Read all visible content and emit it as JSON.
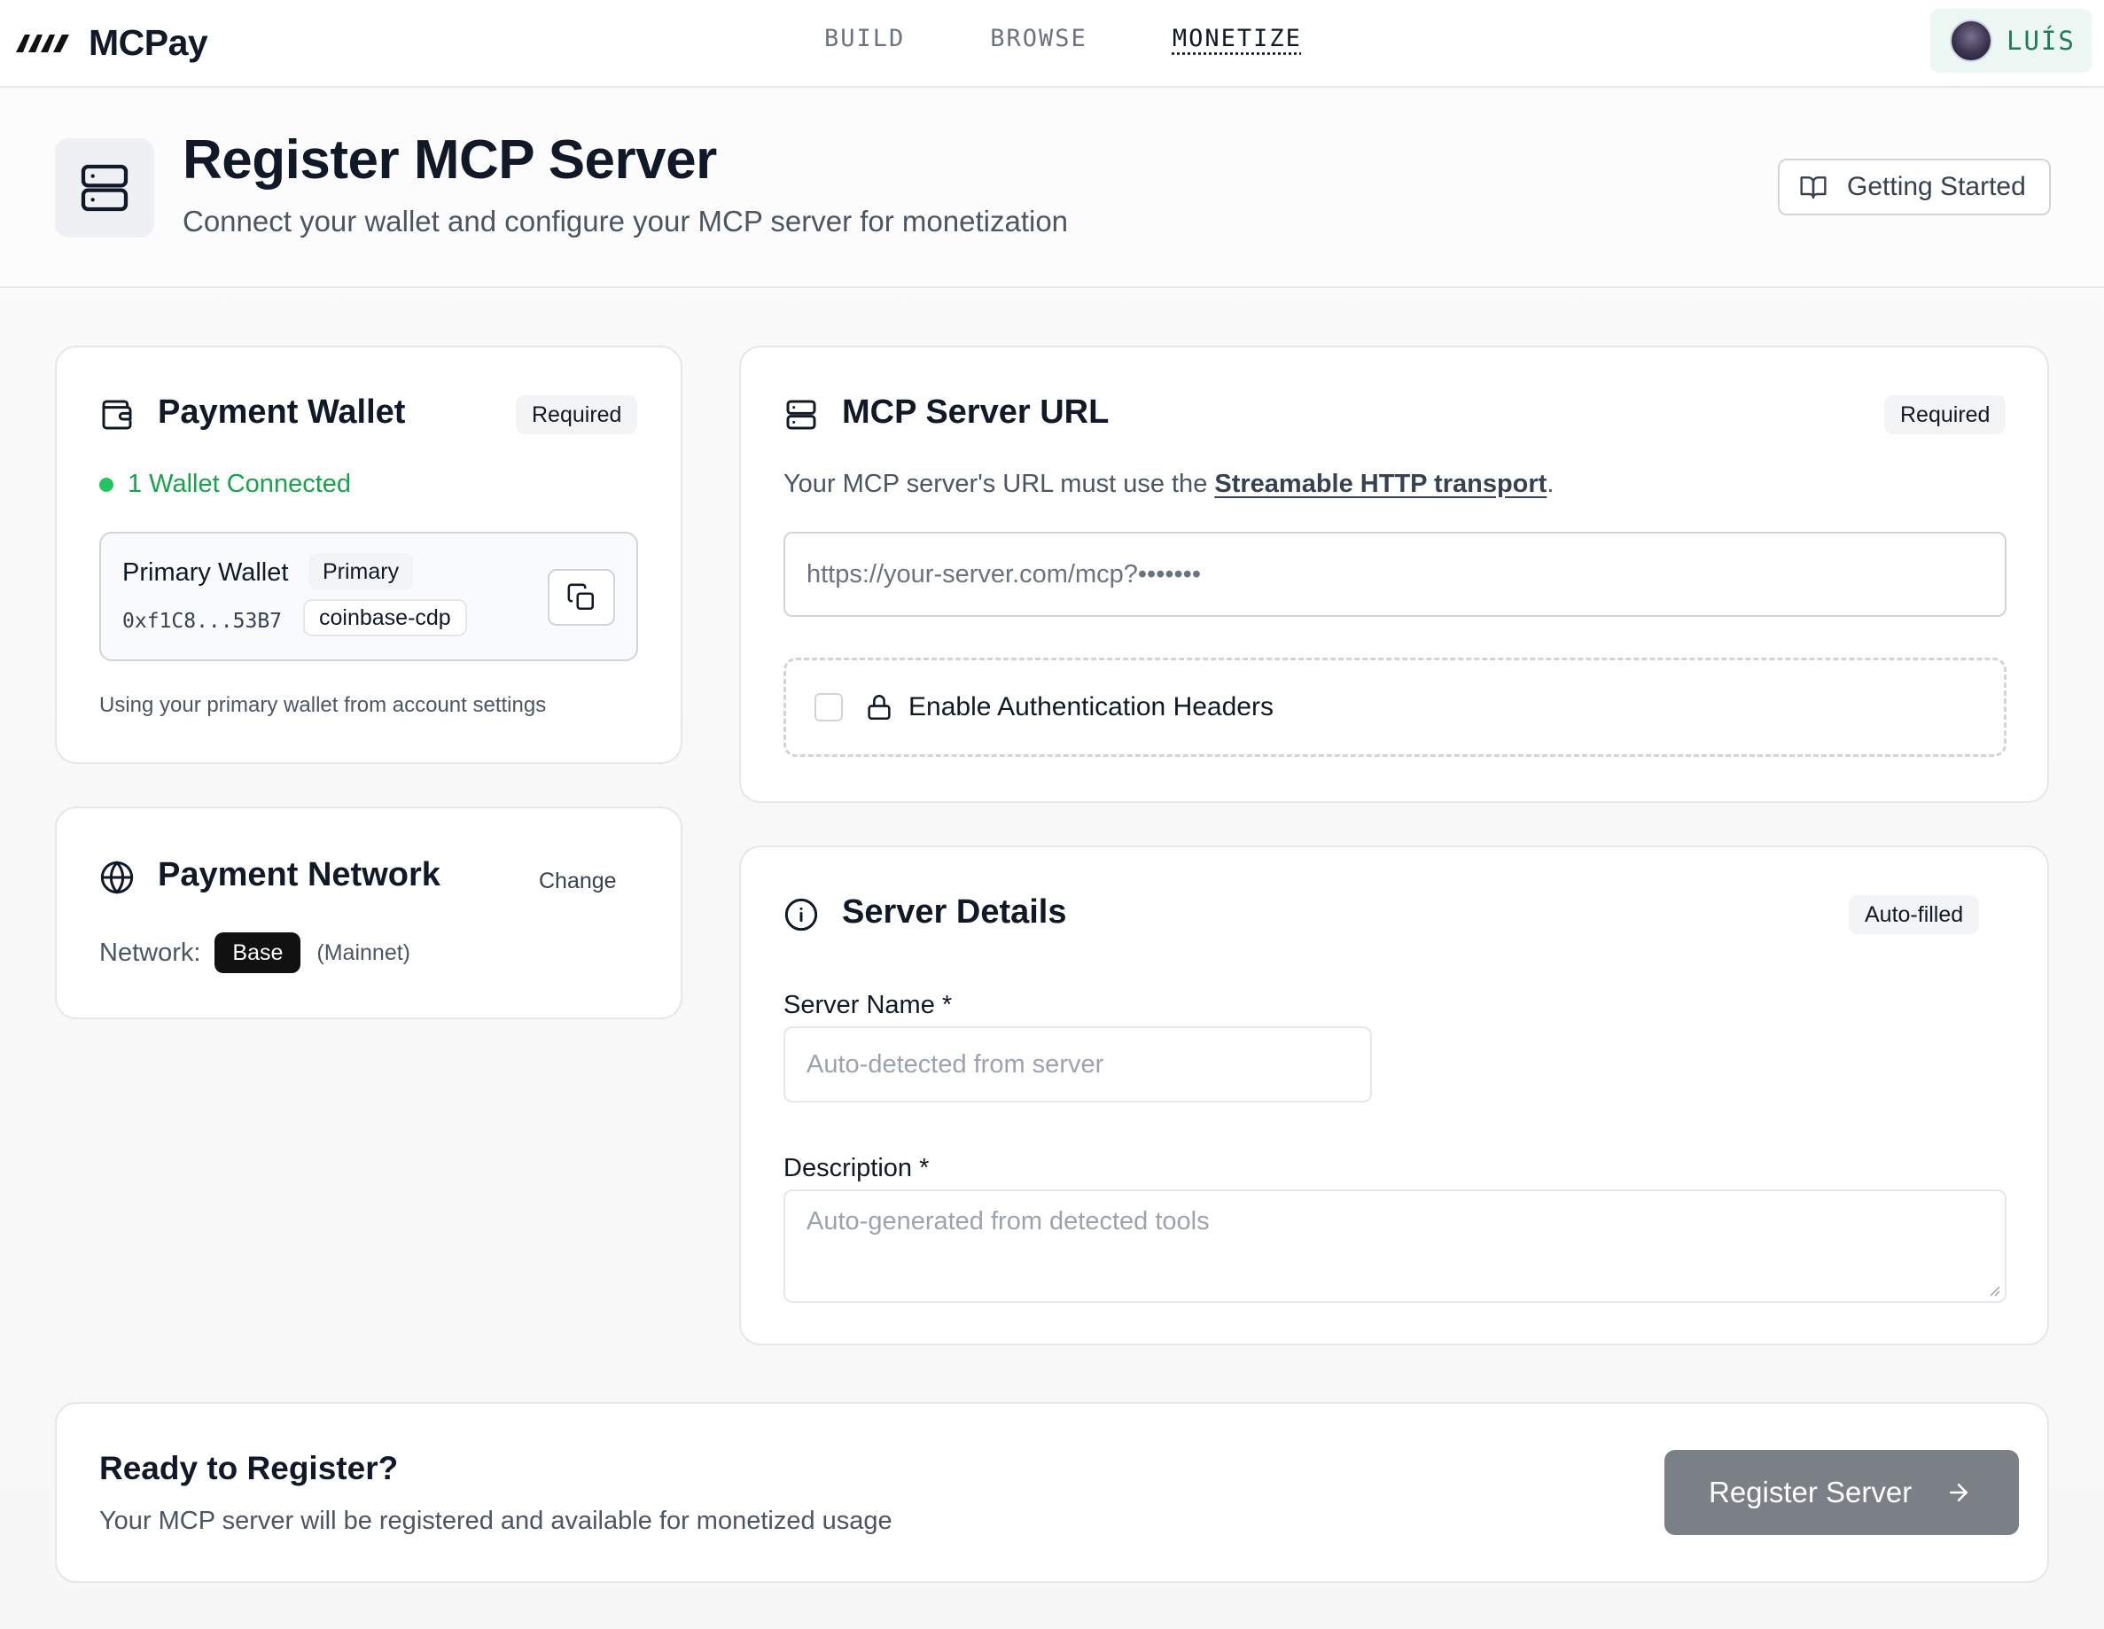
{
  "nav": {
    "brand": "MCPay",
    "links": [
      "BUILD",
      "BROWSE",
      "MONETIZE"
    ],
    "active_link": "MONETIZE",
    "user": "LUÍS"
  },
  "header": {
    "title": "Register MCP Server",
    "subtitle": "Connect your wallet and configure your MCP server for monetization",
    "getting_started": "Getting Started"
  },
  "wallet": {
    "title": "Payment Wallet",
    "badge": "Required",
    "status": "1 Wallet Connected",
    "primary_name": "Primary Wallet",
    "primary_badge": "Primary",
    "address": "0xf1C8...53B7",
    "provider": "coinbase-cdp",
    "note": "Using your primary wallet from account settings"
  },
  "network": {
    "title": "Payment Network",
    "change": "Change",
    "label": "Network:",
    "value": "Base",
    "qualifier": "(Mainnet)"
  },
  "server_url": {
    "title": "MCP Server URL",
    "badge": "Required",
    "desc_prefix": "Your MCP server's URL must use the ",
    "desc_link": "Streamable HTTP transport",
    "desc_suffix": ".",
    "placeholder": "https://your-server.com/mcp?•••••••",
    "auth_label": "Enable Authentication Headers"
  },
  "details": {
    "title": "Server Details",
    "badge": "Auto-filled",
    "name_label": "Server Name *",
    "name_placeholder": "Auto-detected from server",
    "desc_label": "Description *",
    "desc_placeholder": "Auto-generated from detected tools"
  },
  "register": {
    "title": "Ready to Register?",
    "subtitle": "Your MCP server will be registered and available for monetized usage",
    "button": "Register Server"
  },
  "colors": {
    "success": "#16a34a",
    "button_disabled": "#7b7f86",
    "user_bg": "#ecf6f3",
    "user_text": "#1f7a60"
  }
}
